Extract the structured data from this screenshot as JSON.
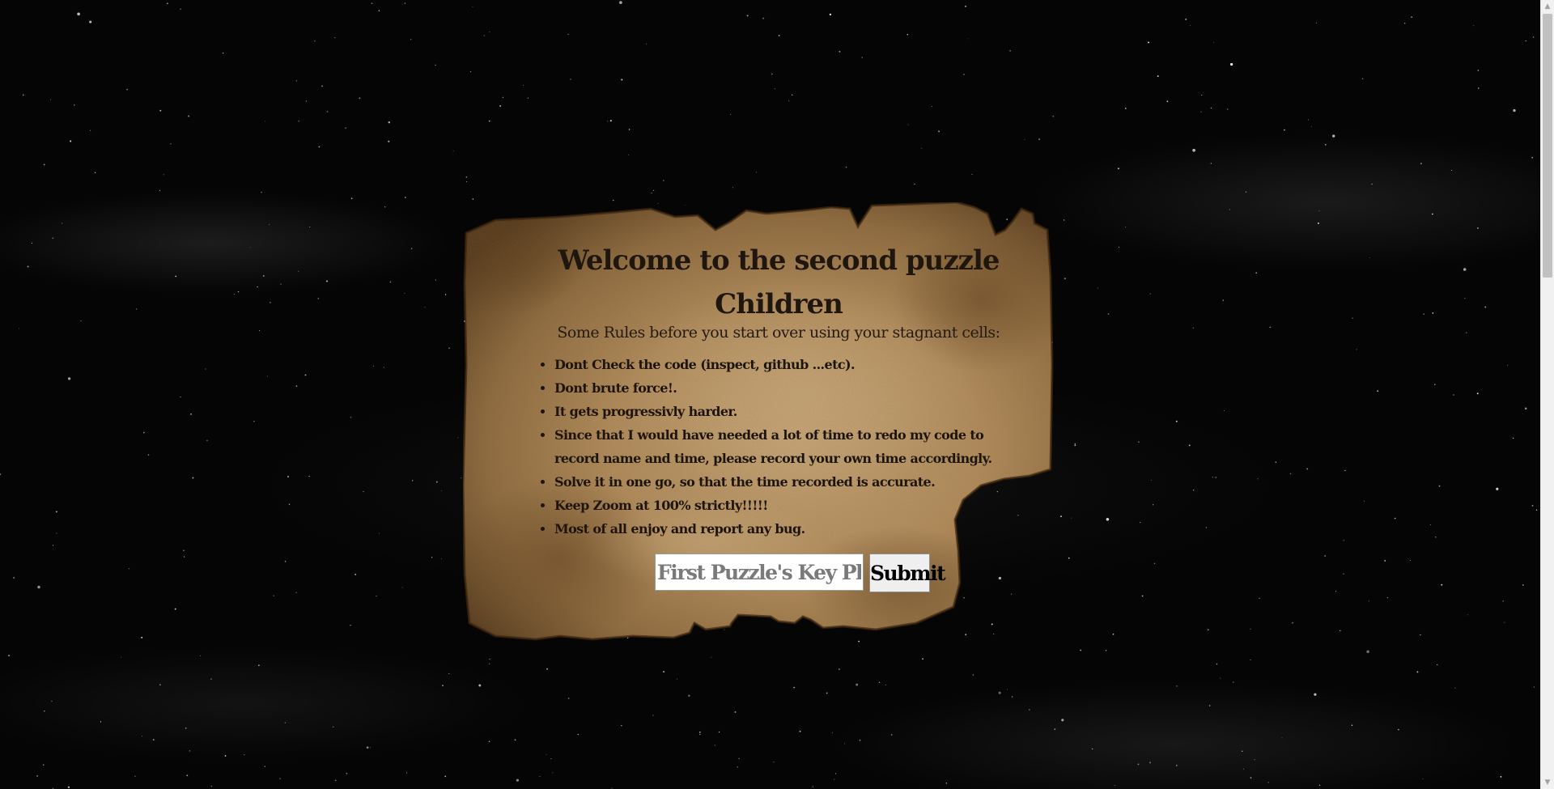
{
  "page": {
    "title_line1": "Welcome to the second puzzle",
    "title_line2": "Children",
    "subtitle": "Some Rules before you start over using your stagnant cells:"
  },
  "rules": [
    "Dont Check the code (inspect, github ...etc).",
    "Dont brute force!.",
    "It gets progressivly harder.",
    "Since that I would have needed a lot of time to redo my code to record name and time, please record your own time accordingly.",
    "Solve it in one go, so that the time recorded is accurate.",
    "Keep Zoom at 100% strictly!!!!!",
    "Most of all enjoy and report any bug."
  ],
  "form": {
    "key_placeholder": "First Puzzle's Key Please",
    "key_value": "",
    "submit_label": "Submit"
  },
  "colors": {
    "background": "#050505",
    "parchment": "#b9976a",
    "parchment_dark": "#6b4a26",
    "text": "#1d150c"
  },
  "icons": {
    "scroll_up": "triangle-up-icon",
    "scroll_down": "triangle-down-icon"
  }
}
